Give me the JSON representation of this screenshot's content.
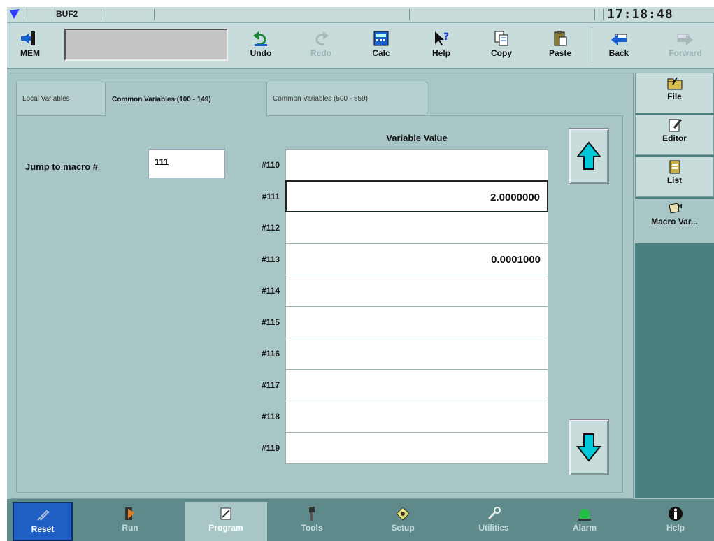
{
  "titlebar": {
    "mode": "BUF2",
    "clock": "17:18:48"
  },
  "toolbar": {
    "mem": "MEM",
    "undo": "Undo",
    "redo": "Redo",
    "calc": "Calc",
    "help": "Help",
    "copy": "Copy",
    "paste": "Paste",
    "back": "Back",
    "forward": "Forward"
  },
  "tabs": [
    {
      "label": "Local Variables"
    },
    {
      "label": "Common Variables (100 - 149)"
    },
    {
      "label": "Common Variables (500 - 559)"
    }
  ],
  "jump": {
    "label": "Jump to macro #",
    "value": "111"
  },
  "table": {
    "header": "Variable Value",
    "rows": [
      {
        "label": "#110",
        "value": ""
      },
      {
        "label": "#111",
        "value": "2.0000000"
      },
      {
        "label": "#112",
        "value": ""
      },
      {
        "label": "#113",
        "value": "0.0001000"
      },
      {
        "label": "#114",
        "value": ""
      },
      {
        "label": "#115",
        "value": ""
      },
      {
        "label": "#116",
        "value": ""
      },
      {
        "label": "#117",
        "value": ""
      },
      {
        "label": "#118",
        "value": ""
      },
      {
        "label": "#119",
        "value": ""
      }
    ]
  },
  "rightnav": {
    "file": "File",
    "editor": "Editor",
    "list": "List",
    "macro": "Macro Var..."
  },
  "bottombar": {
    "reset": "Reset",
    "run": "Run",
    "program": "Program",
    "tools": "Tools",
    "setup": "Setup",
    "utilities": "Utilities",
    "alarm": "Alarm",
    "help": "Help"
  },
  "colors": {
    "panel": "#a9c6c6",
    "toolbar": "#c8dcdc",
    "sidebar": "#4c7f80",
    "accent": "#00c8d8",
    "reset": "#1f5fc4"
  }
}
